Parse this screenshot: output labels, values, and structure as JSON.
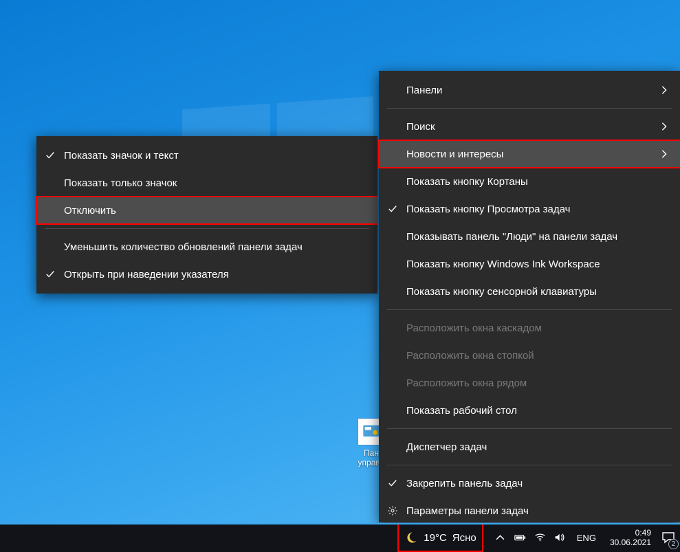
{
  "desktop": {
    "icon_label_line1": "Пан",
    "icon_label_line2": "управл"
  },
  "sub_menu": {
    "items": [
      {
        "label": "Показать значок и текст",
        "checked": true
      },
      {
        "label": "Показать только значок",
        "checked": false
      },
      {
        "label": "Отключить",
        "checked": false,
        "hover": true,
        "boxed": true
      }
    ],
    "items2": [
      {
        "label": "Уменьшить количество обновлений панели задач",
        "checked": false
      },
      {
        "label": "Открыть при наведении указателя",
        "checked": true
      }
    ]
  },
  "main_menu": {
    "g1": [
      {
        "label": "Панели",
        "arrow": true
      },
      {
        "label": "Поиск",
        "arrow": true
      },
      {
        "label": "Новости и интересы",
        "arrow": true,
        "hover": true,
        "boxed": true
      },
      {
        "label": "Показать кнопку Кортаны"
      },
      {
        "label": "Показать кнопку Просмотра задач",
        "checked": true
      },
      {
        "label": "Показывать панель \"Люди\" на панели задач"
      },
      {
        "label": "Показать кнопку Windows Ink Workspace"
      },
      {
        "label": "Показать кнопку сенсорной клавиатуры"
      }
    ],
    "g2": [
      {
        "label": "Расположить окна каскадом",
        "disabled": true
      },
      {
        "label": "Расположить окна стопкой",
        "disabled": true
      },
      {
        "label": "Расположить окна рядом",
        "disabled": true
      },
      {
        "label": "Показать рабочий стол"
      }
    ],
    "g3": [
      {
        "label": "Диспетчер задач"
      }
    ],
    "g4": [
      {
        "label": "Закрепить панель задач",
        "checked": true
      },
      {
        "label": "Параметры панели задач",
        "gear": true
      }
    ]
  },
  "taskbar": {
    "weather_temp": "19°C",
    "weather_desc": "Ясно",
    "lang": "ENG",
    "time": "0:49",
    "date": "30.06.2021",
    "notif_count": "2"
  }
}
